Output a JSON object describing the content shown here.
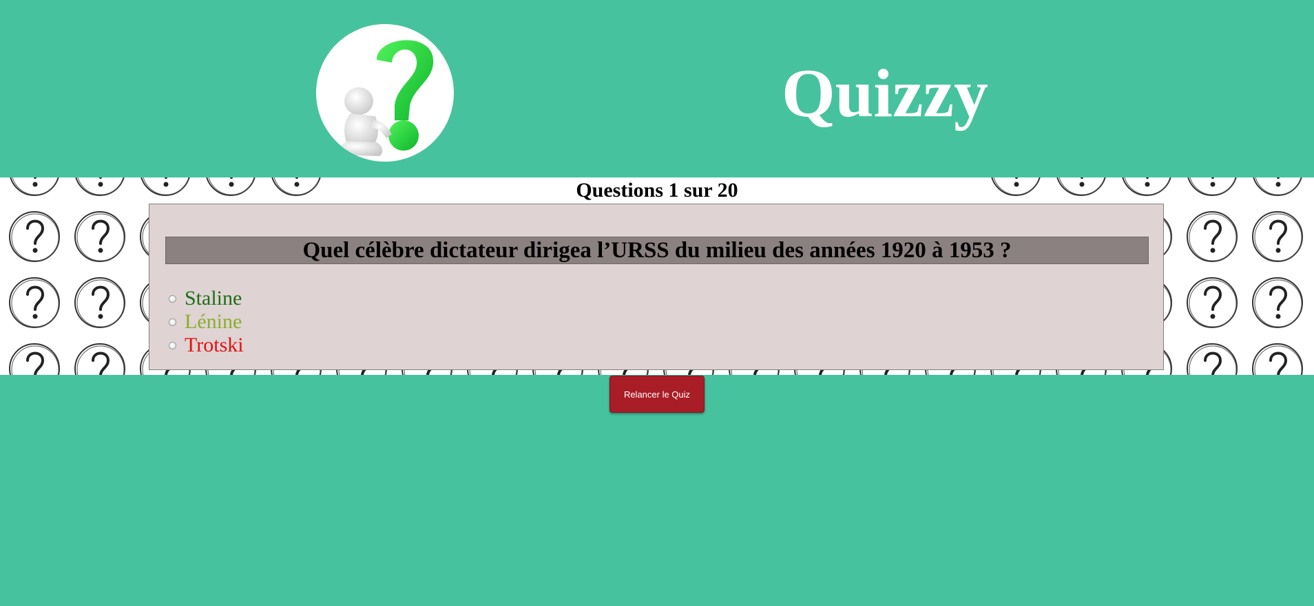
{
  "app": {
    "title": "Quizzy",
    "logo_icon": "question-mark-person-icon"
  },
  "quiz": {
    "counter": "Questions 1 sur 20",
    "question": "Quel célèbre dictateur dirigea l’URSS du milieu des années 1920 à 1953 ?",
    "options": [
      {
        "label": "Staline",
        "color": "#1f6e1a"
      },
      {
        "label": "Lénine",
        "color": "#8aae2c"
      },
      {
        "label": "Trotski",
        "color": "#e31111"
      }
    ]
  },
  "actions": {
    "restart_label": "Relancer le Quiz"
  },
  "colors": {
    "background": "#46c39e",
    "card": "#dfd3d3",
    "question_bar": "#8c8181",
    "restart_button": "#a91d27"
  }
}
